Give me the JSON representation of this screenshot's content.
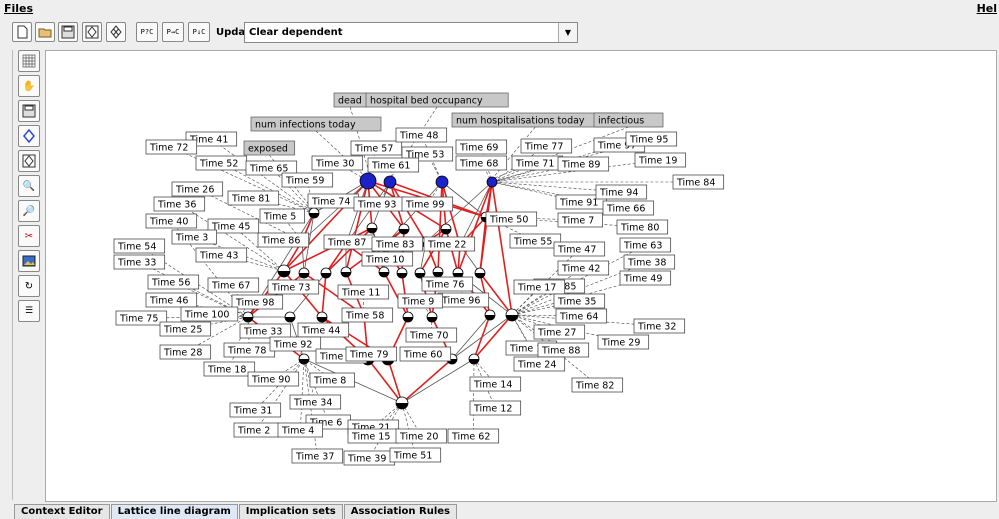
{
  "menu": {
    "files": "Files",
    "help": "Hel"
  },
  "toolbar": {
    "buttons": [
      "new-icon",
      "open-icon",
      "save-icon",
      "lattice-icon",
      "lattice-alt-icon",
      "P?C",
      "P→C",
      "P↓C"
    ],
    "update_label": "Update:",
    "update_value": "Clear dependent"
  },
  "side_tools": [
    "grid-icon",
    "hand-icon",
    "save-icon",
    "diamond-icon",
    "diamond-hatched-icon",
    "zoom-in-icon",
    "zoom-out-icon",
    "scissors-icon",
    "image-icon",
    "cycle-icon",
    "list-icon"
  ],
  "tabs": [
    "Context Editor",
    "Lattice line diagram",
    "Implication sets",
    "Association Rules"
  ],
  "active_tab": "Lattice line diagram",
  "diagram": {
    "attribute_labels": [
      "dead",
      "hospital bed occupancy",
      "num infections today",
      "num hospitalisations today",
      "infectious",
      "exposed"
    ],
    "object_labels": [
      "Time 41",
      "Time 72",
      "Time 52",
      "Time 65",
      "Time 57",
      "Time 48",
      "Time 53",
      "Time 69",
      "Time 77",
      "Time 97",
      "Time 95",
      "Time 30",
      "Time 61",
      "Time 68",
      "Time 71",
      "Time 89",
      "Time 19",
      "Time 84",
      "Time 26",
      "Time 59",
      "Time 81",
      "Time 36",
      "Time 74",
      "Time 93",
      "Time 99",
      "Time 91",
      "Time 66",
      "Time 94",
      "Time 40",
      "Time 45",
      "Time 5",
      "Time 50",
      "Time 7",
      "Time 80",
      "Time 3",
      "Time 86",
      "Time 87",
      "Time 83",
      "Time 22",
      "Time 55",
      "Time 63",
      "Time 54",
      "Time 43",
      "Time 47",
      "Time 33",
      "Time 10",
      "Time 38",
      "Time 42",
      "Time 49",
      "Time 56",
      "Time 67",
      "Time 73",
      "Time 76",
      "Time 85",
      "Time 46",
      "Time 11",
      "Time 96",
      "Time 17",
      "Time 35",
      "Time 98",
      "Time 9",
      "Time 64",
      "Time 75",
      "Time 100",
      "Time 58",
      "Time 32",
      "Time 25",
      "Time 33",
      "Time 44",
      "Time 70",
      "Time 27",
      "Time 29",
      "Time 28",
      "Time 78",
      "Time 92",
      "Time 16",
      "Time 88",
      "Time 23",
      "Time 60",
      "Time 79",
      "Time 18",
      "Time 24",
      "Time 90",
      "Time 8",
      "Time 14",
      "Time 82",
      "Time 34",
      "Time 31",
      "Time 12",
      "Time 6",
      "Time 21",
      "Time 2",
      "Time 4",
      "Time 15",
      "Time 20",
      "Time 62",
      "Time 37",
      "Time 39",
      "Time 51"
    ]
  }
}
